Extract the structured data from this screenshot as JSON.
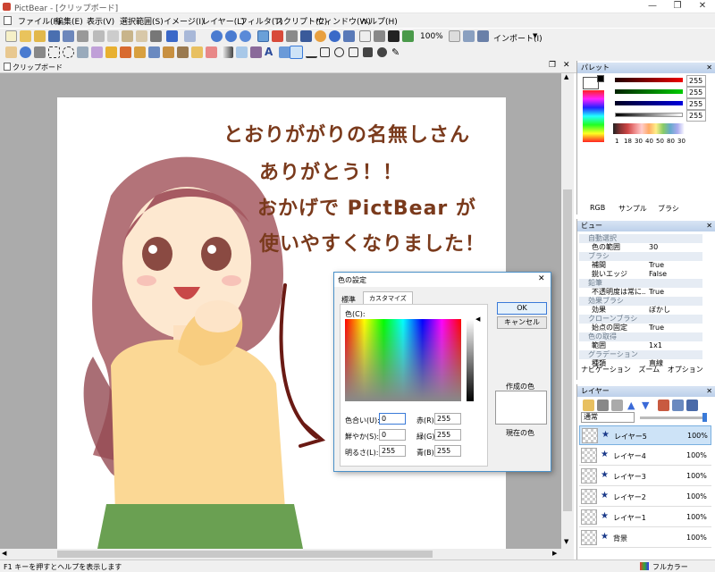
{
  "window": {
    "title": "PictBear - [クリップボード]"
  },
  "menu": [
    "ファイル(F)",
    "編集(E)",
    "表示(V)",
    "選択範囲(S)",
    "イメージ(I)",
    "レイヤー(L)",
    "フィルタ(T)",
    "スクリプト(C)",
    "ウィンドウ(W)",
    "ヘルプ(H)"
  ],
  "toolbar": {
    "zoom": "100%",
    "import_label": "インポート(I)"
  },
  "doc_tab": "クリップボード",
  "drawing_text": [
    "とおりががりの名無しさん",
    "ありがとう！！",
    "おかげで PictBear が",
    "使いやすくなりました！"
  ],
  "palette": {
    "title": "パレット",
    "values": [
      "255",
      "255",
      "255",
      "255"
    ],
    "brush_sizes": [
      "1",
      "18",
      "30",
      "40",
      "50",
      "80",
      "30"
    ],
    "tabs": [
      "RGB",
      "サンプル",
      "ブラシ"
    ]
  },
  "view": {
    "title": "ビュー",
    "rows": [
      {
        "k": "自動選択",
        "v": "",
        "cat": true
      },
      {
        "k": "色の範囲",
        "v": "30"
      },
      {
        "k": "ブラシ",
        "v": "",
        "cat": true
      },
      {
        "k": "補間",
        "v": "True"
      },
      {
        "k": "鋭いエッジ",
        "v": "False"
      },
      {
        "k": "鉛筆",
        "v": "",
        "cat": true
      },
      {
        "k": "不透明度は常に...",
        "v": "True"
      },
      {
        "k": "効果ブラシ",
        "v": "",
        "cat": true
      },
      {
        "k": "効果",
        "v": "ぼかし"
      },
      {
        "k": "クローンブラシ",
        "v": "",
        "cat": true
      },
      {
        "k": "始点の固定",
        "v": "True"
      },
      {
        "k": "色の取得",
        "v": "",
        "cat": true
      },
      {
        "k": "範囲",
        "v": "1x1"
      },
      {
        "k": "グラデーション",
        "v": "",
        "cat": true
      },
      {
        "k": "種類",
        "v": "直線"
      }
    ],
    "tabs": [
      "ナビゲーション",
      "ズーム",
      "オプション"
    ]
  },
  "layers": {
    "title": "レイヤー",
    "blend": "通常",
    "items": [
      {
        "name": "レイヤー5",
        "opacity": "100%"
      },
      {
        "name": "レイヤー4",
        "opacity": "100%"
      },
      {
        "name": "レイヤー3",
        "opacity": "100%"
      },
      {
        "name": "レイヤー2",
        "opacity": "100%"
      },
      {
        "name": "レイヤー1",
        "opacity": "100%"
      },
      {
        "name": "背景",
        "opacity": "100%"
      }
    ]
  },
  "dialog": {
    "title": "色の設定",
    "tabs": [
      "標準",
      "カスタマイズ"
    ],
    "color_label": "色(C):",
    "ok": "OK",
    "cancel": "キャンセル",
    "created_label": "作成の色",
    "current_label": "現在の色",
    "hue_label": "色合い(U):",
    "hue": "0",
    "sat_label": "鮮やか(S):",
    "sat": "0",
    "lum_label": "明るさ(L):",
    "lum": "255",
    "red_label": "赤(R):",
    "red": "255",
    "green_label": "緑(G):",
    "green": "255",
    "blue_label": "青(B):",
    "blue": "255"
  },
  "status": {
    "text": "F1 キーを押すとヘルプを表示します",
    "mode": "フルカラー"
  },
  "colors": {
    "title_bg": "#ffffff",
    "panel_head": "#c6d6ec",
    "accent": "#4a90c8",
    "text_brown": "#7a3a1c",
    "selected_layer": "#cde3f7"
  }
}
